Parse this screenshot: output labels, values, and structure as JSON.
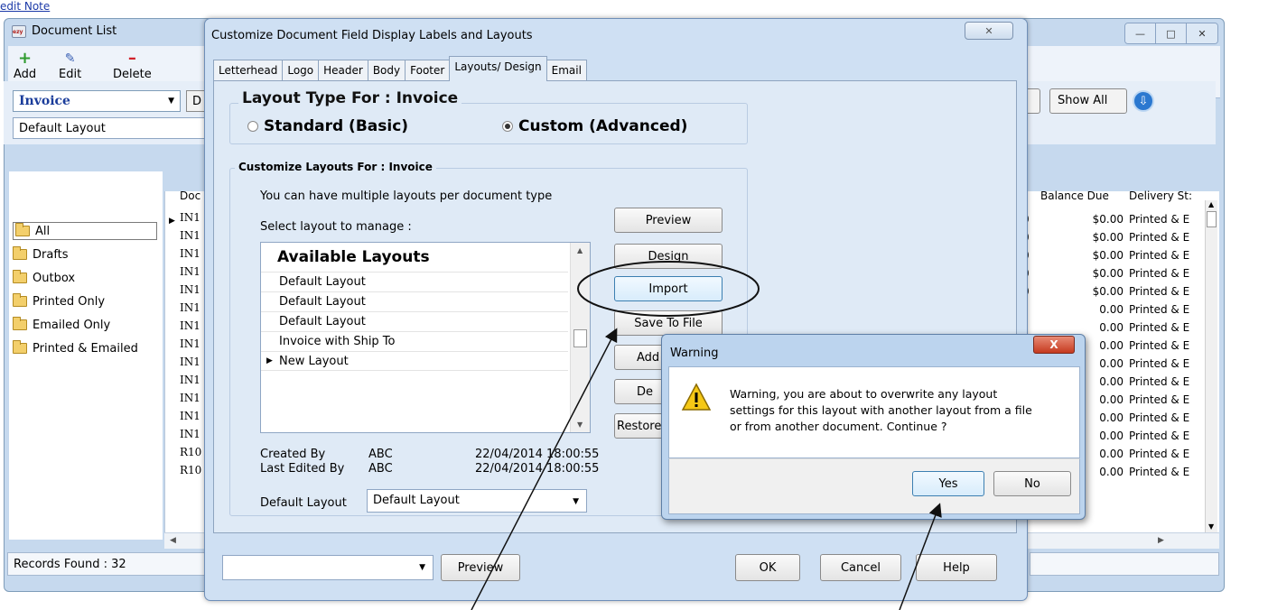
{
  "background": {
    "edit_note": "edit Note",
    "window_title": "Document List",
    "toolbar": {
      "add": "Add",
      "edit": "Edit",
      "delete": "Delete"
    },
    "doc_type_value": "Invoice",
    "d_button": "D",
    "layout_value": "Default Layout",
    "show_all": "Show All",
    "folders": [
      "All",
      "Drafts",
      "Outbox",
      "Printed Only",
      "Emailed Only",
      "Printed & Emailed"
    ],
    "grid_header_left": "Doc",
    "doc_numbers": [
      "IN1",
      "IN1",
      "IN1",
      "IN1",
      "IN1",
      "IN1",
      "IN1",
      "IN1",
      "IN1",
      "IN1",
      "IN1",
      "IN1",
      "IN1",
      "R10",
      "R10"
    ],
    "grid_header_balance": "Balance Due",
    "grid_header_delivery": "Delivery St:",
    "balance_values": [
      "$0.00",
      "$0.00",
      "$0.00",
      "$0.00",
      "$0.00",
      "0.00",
      "0.00",
      "0.00",
      "0.00",
      "0.00",
      "0.00",
      "0.00",
      "0.00",
      "0.00",
      "0.00"
    ],
    "delivery_values": [
      "Printed & E",
      "Printed & E",
      "Printed & E",
      "Printed & E",
      "Printed & E",
      "Printed & E",
      "Printed & E",
      "Printed & E",
      "Printed & E",
      "Printed & E",
      "Printed & E",
      "Printed & E",
      "Printed & E",
      "Printed & E",
      "Printed & E"
    ],
    "records_found": "Records Found : 32"
  },
  "dialog": {
    "title": "Customize Document Field Display Labels and Layouts",
    "tabs": [
      "Letterhead",
      "Logo",
      "Header",
      "Body",
      "Footer",
      "Layouts/ Design",
      "Email"
    ],
    "active_tab": "Layouts/ Design",
    "layout_type_title": "Layout Type For : Invoice",
    "radio_standard": "Standard (Basic)",
    "radio_custom": "Custom (Advanced)",
    "selected_radio": "Custom (Advanced)",
    "customize_title": "Customize Layouts For : Invoice",
    "info_text": "You can have multiple layouts per document type",
    "select_label": "Select layout to manage :",
    "list_header": "Available Layouts",
    "layouts": [
      "Default Layout",
      "Default Layout",
      "Default Layout",
      "Invoice with Ship To",
      "New Layout"
    ],
    "selected_layout": "New Layout",
    "buttons": [
      "Preview",
      "Design",
      "Import",
      "Save To File",
      "Add",
      "De",
      "Restore"
    ],
    "created_by_label": "Created By",
    "created_by_value": "ABC",
    "created_date": "22/04/2014 18:00:55",
    "last_edited_label": "Last Edited By",
    "last_edited_value": "ABC",
    "last_edited_date": "22/04/2014 18:00:55",
    "default_layout_label": "Default Layout",
    "default_layout_value": "Default Layout",
    "bottom_combo_value": "",
    "bottom_preview": "Preview",
    "ok": "OK",
    "cancel": "Cancel",
    "help": "Help"
  },
  "warning": {
    "title": "Warning",
    "close": "X",
    "message_lines": [
      "Warning, you are about to overwrite any layout",
      "settings for this layout with another layout from a file",
      "or from another document. Continue ?"
    ],
    "yes": "Yes",
    "no": "No"
  },
  "icons": {
    "add": "plus-icon",
    "edit": "pencil-icon",
    "delete": "minus-icon",
    "folder": "folder-icon",
    "warning": "warning-triangle-icon",
    "go": "circle-arrow-down-icon"
  },
  "colors": {
    "window_frame": "#c6d9ee",
    "dialog_frame": "#cfe0f3",
    "dialog_body": "#dfeaf6",
    "invoice_text": "#1a3c9a",
    "warn_close": "#c53a1f",
    "accent_focus": "#3c7fb1"
  }
}
